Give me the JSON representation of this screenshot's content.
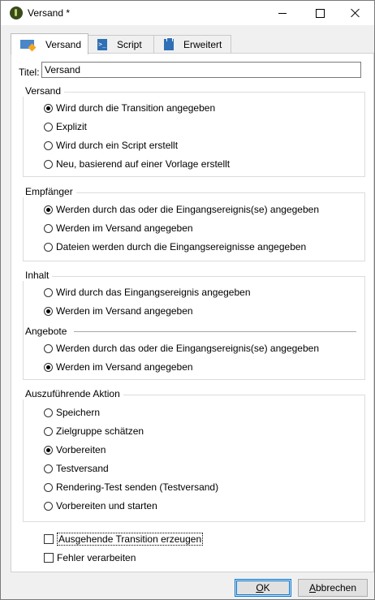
{
  "window": {
    "title": "Versand *"
  },
  "tabs": [
    {
      "label": "Versand",
      "icon": "mail-icon"
    },
    {
      "label": "Script",
      "icon": "script-icon"
    },
    {
      "label": "Erweitert",
      "icon": "clipboard-icon"
    }
  ],
  "title_field": {
    "label": "Titel:",
    "value": "Versand"
  },
  "versand": {
    "legend": "Versand",
    "options": [
      {
        "label": "Wird durch die Transition angegeben",
        "selected": true
      },
      {
        "label": "Explizit",
        "selected": false
      },
      {
        "label": "Wird durch ein Script erstellt",
        "selected": false
      },
      {
        "label": "Neu, basierend auf einer Vorlage erstellt",
        "selected": false
      }
    ]
  },
  "empfaenger": {
    "legend": "Empfänger",
    "options": [
      {
        "label": "Werden durch das oder die Eingangsereignis(se) angegeben",
        "selected": true
      },
      {
        "label": "Werden im Versand angegeben",
        "selected": false
      },
      {
        "label": "Dateien werden durch die Eingangsereignisse angegeben",
        "selected": false
      }
    ]
  },
  "inhalt": {
    "legend": "Inhalt",
    "options": [
      {
        "label": "Wird durch das Eingangsereignis angegeben",
        "selected": false
      },
      {
        "label": "Werden im Versand angegeben",
        "selected": true
      }
    ],
    "angebote": {
      "legend": "Angebote",
      "options": [
        {
          "label": "Werden durch das oder die Eingangsereignis(se) angegeben",
          "selected": false
        },
        {
          "label": "Werden im Versand angegeben",
          "selected": true
        }
      ]
    }
  },
  "aktion": {
    "legend": "Auszuführende Aktion",
    "options": [
      {
        "label": "Speichern",
        "selected": false
      },
      {
        "label": "Zielgruppe schätzen",
        "selected": false
      },
      {
        "label": "Vorbereiten",
        "selected": true
      },
      {
        "label": "Testversand",
        "selected": false
      },
      {
        "label": "Rendering-Test senden (Testversand)",
        "selected": false
      },
      {
        "label": "Vorbereiten und starten",
        "selected": false
      }
    ]
  },
  "checkboxes": [
    {
      "label": "Ausgehende Transition erzeugen",
      "checked": false
    },
    {
      "label": "Fehler verarbeiten",
      "checked": false
    }
  ],
  "buttons": {
    "ok": "OK",
    "cancel": "Abbrechen"
  }
}
